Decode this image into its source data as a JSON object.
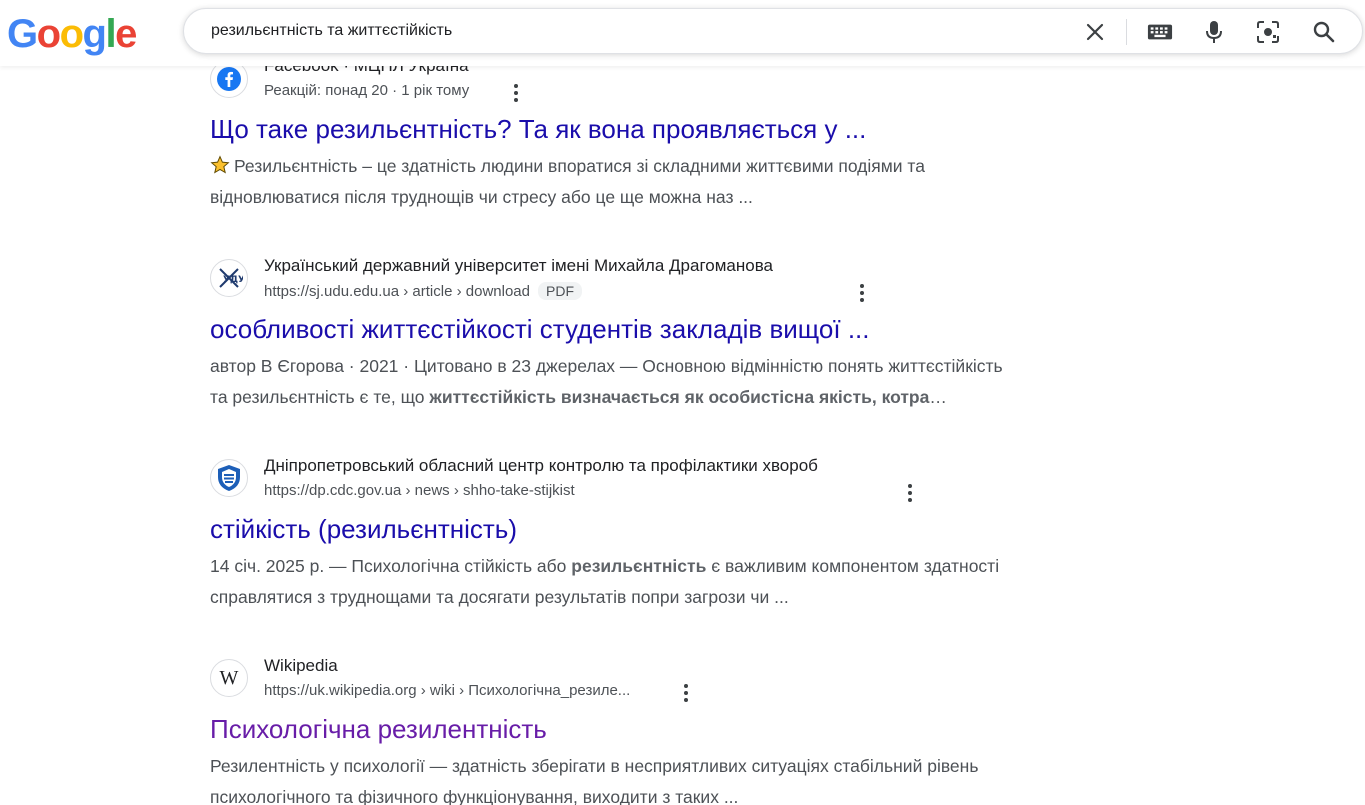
{
  "search": {
    "query": "резильєнтність та життєстійкість"
  },
  "results": [
    {
      "site_name": "Facebook · МЦПЛ Україна",
      "meta_reactions": "Реакцій: понад 20",
      "meta_age": "1 рік тому",
      "title": "Що таке резильєнтність? Та як вона проявляється у ...",
      "snippet_line1": "Резильєнтність – це здатність людини впоратися зі складними життєвими подіями та",
      "snippet_line2": "відновлюватися після труднощів чи стресу або це ще можна наз ...",
      "star_icon": "⭐"
    },
    {
      "site_name": "Український державний університет імені Михайла Драгоманова",
      "url": "https://sj.udu.edu.ua › article › download",
      "badge": "PDF",
      "title": "особливості життєстійкості студентів закладів вищої ...",
      "snippet_line1": "автор В Єгорова · 2021 · Цитовано в 23 джерелах — Основною відмінністю понять життєстійкість",
      "snippet_line2_pre": "та резильєнтність є те, що ",
      "snippet_line2_bold": "життєстійкість визначається як особистісна якість, котра",
      "snippet_line2_post": "…"
    },
    {
      "site_name": "Дніпропетровський обласний центр контролю та профілактики хвороб",
      "url": "https://dp.cdc.gov.ua › news › shho-take-stijkist",
      "title": "стійкість (резильєнтність)",
      "snippet_line1_pre": "14 січ. 2025 р. — Психологічна стійкість або ",
      "snippet_line1_bold": "резильєнтність",
      "snippet_line1_post": " є важливим компонентом здатності",
      "snippet_line2": "справлятися з труднощами та досягати результатів попри загрози чи ..."
    },
    {
      "site_name": "Wikipedia",
      "url": "https://uk.wikipedia.org › wiki › Психологічна_резиле...",
      "favicon_letter": "W",
      "title": "Психологічна резилентність",
      "snippet_line1": "Резилентність у психології — здатність зберігати в несприятливих ситуаціях стабільний рівень",
      "snippet_line2": "психологічного та фізичного функціонування, виходити з таких ..."
    }
  ],
  "colors": {
    "link": "#1a0dab",
    "visited": "#681da8",
    "snippet": "#4d5156"
  }
}
